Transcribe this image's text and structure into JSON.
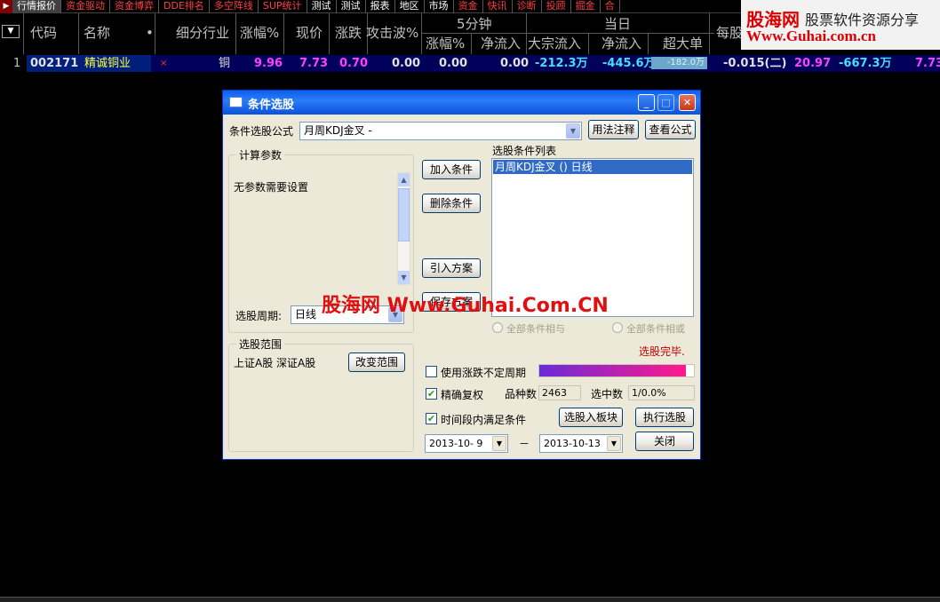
{
  "tabs": [
    "行情报价",
    "资金驱动",
    "资金博弈",
    "DDE排名",
    "多空阵线",
    "SUP统计",
    "测试",
    "测试",
    "报表",
    "地区",
    "市场",
    "资金",
    "快讯",
    "诊断",
    "投顾",
    "掘金",
    "合"
  ],
  "header": {
    "code": "代码",
    "name": "名称",
    "dot": "•",
    "industry": "细分行业",
    "change_pct": "涨幅%",
    "price": "现价",
    "change": "涨跌",
    "attack_wave": "攻击波%",
    "group_5min": "5分钟",
    "group_today": "当日",
    "m5_change": "涨幅%",
    "m5_netflow": "净流入",
    "block_inflow": "大宗流入",
    "day_netflow": "净流入",
    "super_large": "超大单",
    "per_share": "每股"
  },
  "row": {
    "index": "1",
    "code": "002171",
    "name": "精诚铜业",
    "mark": "×",
    "industry": "铜",
    "change_pct": "9.96",
    "price": "7.73",
    "change": "0.70",
    "attack_wave": "0.00",
    "m5_change": "0.00",
    "m5_netflow": "0.00",
    "block_inflow": "-212.3万",
    "day_netflow": "-445.6万",
    "super_large": "-182.0万",
    "per_share": "-0.015(二)",
    "v1": "20.97",
    "v2": "-667.3万",
    "v3": "7.73"
  },
  "logo": {
    "line1": "股海网",
    "line2": "股票软件资源分享",
    "line3": "Www.Guhai.com.cn"
  },
  "watermark": "股海网 Www.Guhai.Com.CN",
  "dialog": {
    "title": "条件选股",
    "formula_label": "条件选股公式",
    "formula_value": "月周KDJ金叉 -",
    "usage_btn": "用法注释",
    "view_btn": "查看公式",
    "params_group": "计算参数",
    "params_text": "无参数需要设置",
    "period_label": "选股周期:",
    "period_value": "日线",
    "range_group": "选股范围",
    "range_text": "上证A股 深证A股",
    "change_range_btn": "改变范围",
    "add_btn": "加入条件",
    "del_btn": "删除条件",
    "import_btn": "引入方案",
    "save_btn": "保存方案",
    "cond_list_label": "选股条件列表",
    "cond_items": [
      "月周KDJ金叉 () 日线"
    ],
    "radio_and": "全部条件相与",
    "radio_or": "全部条件相或",
    "status": "选股完毕.",
    "use_uncertain": "使用涨跌不定周期",
    "exact_rights": "精确复权",
    "count_label": "品种数",
    "count_value": "2463",
    "selected_label": "选中数",
    "selected_value": "1/0.0%",
    "time_satisfy": "时间段内满足条件",
    "to_board_btn": "选股入板块",
    "run_btn": "执行选股",
    "date_from": "2013-10- 9",
    "date_sep": "－",
    "date_to": "2013-10-13",
    "close_btn": "关闭",
    "progress": 1.0,
    "colors": {
      "title_bar": "#0a5ff0",
      "progress_start": "#6a2bd8",
      "progress_end": "#ff1a8c",
      "status": "#c00000"
    }
  }
}
